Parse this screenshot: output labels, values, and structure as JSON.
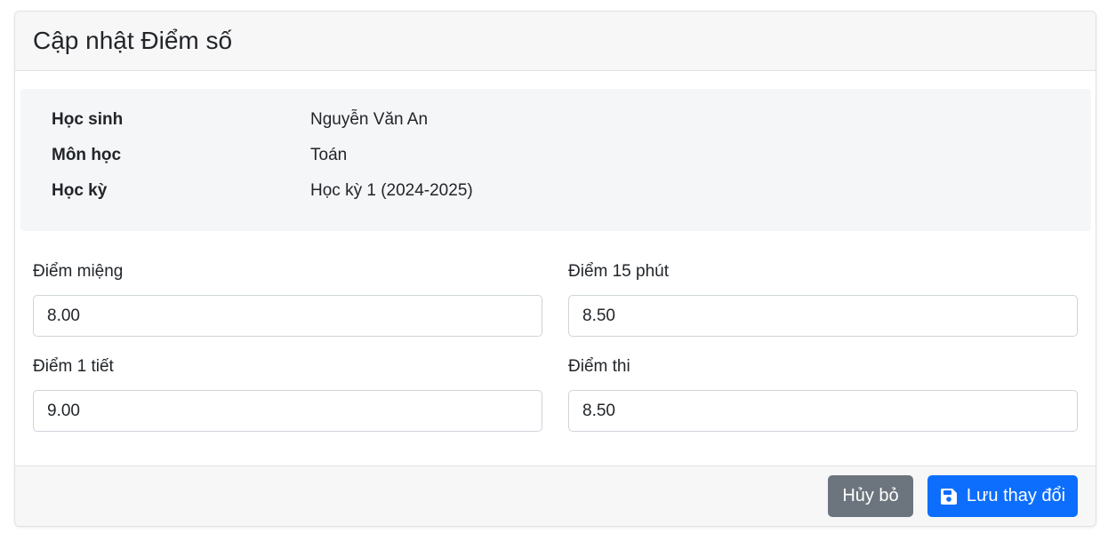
{
  "header": {
    "title": "Cập nhật Điểm số"
  },
  "info": {
    "student_label": "Học sinh",
    "student_value": "Nguyễn Văn An",
    "subject_label": "Môn học",
    "subject_value": "Toán",
    "term_label": "Học kỳ",
    "term_value": "Học kỳ 1 (2024-2025)"
  },
  "fields": {
    "oral": {
      "label": "Điểm miệng",
      "value": "8.00"
    },
    "quiz15": {
      "label": "Điểm 15 phút",
      "value": "8.50"
    },
    "test1": {
      "label": "Điểm 1 tiết",
      "value": "9.00"
    },
    "exam": {
      "label": "Điểm thi",
      "value": "8.50"
    }
  },
  "footer": {
    "cancel_label": "Hủy bỏ",
    "save_label": "Lưu thay đổi",
    "save_icon": "floppy-disk-icon"
  },
  "colors": {
    "primary": "#0d6efd",
    "secondary": "#6c757d"
  }
}
